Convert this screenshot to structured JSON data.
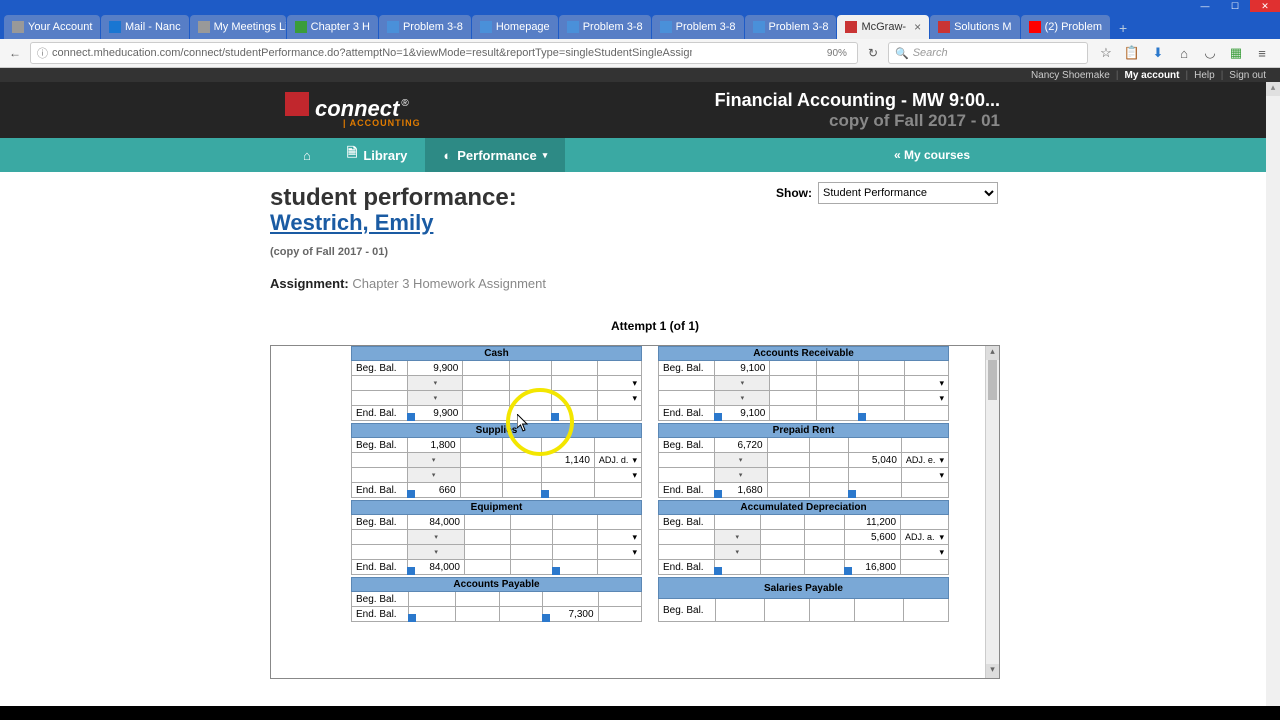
{
  "window": {
    "min": "—",
    "max": "☐",
    "close": "✕"
  },
  "tabs": [
    {
      "label": "Your Account",
      "icon": "generic"
    },
    {
      "label": "Mail - Nanc",
      "icon": "outlook"
    },
    {
      "label": "My Meetings List",
      "icon": "generic"
    },
    {
      "label": "Chapter 3 H",
      "icon": "green"
    },
    {
      "label": "Problem 3-8",
      "icon": "blue"
    },
    {
      "label": "Homepage",
      "icon": "blue"
    },
    {
      "label": "Problem 3-8",
      "icon": "blue"
    },
    {
      "label": "Problem 3-8",
      "icon": "blue"
    },
    {
      "label": "Problem 3-8",
      "icon": "blue"
    },
    {
      "label": "McGraw-",
      "icon": "red",
      "active": true,
      "closeable": true
    },
    {
      "label": "Solutions M",
      "icon": "red"
    },
    {
      "label": "(2) Problem",
      "icon": "yt"
    }
  ],
  "nav": {
    "back": "←",
    "lock": "ⓘ",
    "url": "connect.mheducation.com/connect/studentPerformance.do?attemptNo=1&viewMode=result&reportType=singleStudentSingleAssignment&peek=tru",
    "zoom": "90%",
    "reload": "↻",
    "search_icon": "🔍",
    "search_placeholder": "Search"
  },
  "nav_icons": {
    "star": "☆",
    "list": "📋",
    "dl": "⬇",
    "home": "⌂",
    "pocket": "◡",
    "grid": "▦",
    "menu": "≡"
  },
  "topstrip": {
    "user": "Nancy Shoemake",
    "myaccount": "My account",
    "help": "Help",
    "signout": "Sign out"
  },
  "brand": {
    "name": "connect",
    "reg": "®",
    "sub": "| ACCOUNTING",
    "course": "Financial Accounting - MW 9:00...",
    "term": "copy of Fall 2017 - 01"
  },
  "menu": {
    "home_icon": "⌂",
    "library_icon": "🗎",
    "library": "Library",
    "perf_icon": "◐",
    "performance": "Performance",
    "caret": "▾",
    "mycourses": "« My courses"
  },
  "content": {
    "heading": "student performance:",
    "student": "Westrich, Emily",
    "copyof": "(copy of Fall 2017 - 01)",
    "assignment_lbl": "Assignment:",
    "assignment_val": "Chapter 3 Homework Assignment",
    "show_lbl": "Show:",
    "show_val": "Student Performance",
    "attempt": "Attempt 1 (of 1)"
  },
  "accounts": [
    {
      "left": {
        "title": "Cash",
        "beg": "9,900",
        "rows": [
          {
            "dr": "",
            "drn": "",
            "cr": "",
            "crn": ""
          },
          {
            "dr": "",
            "drn": "",
            "cr": "",
            "crn": ""
          }
        ],
        "end": "9,900"
      },
      "right": {
        "title": "Accounts Receivable",
        "beg": "9,100",
        "rows": [
          {
            "dr": "",
            "drn": "",
            "cr": "",
            "crn": ""
          },
          {
            "dr": "",
            "drn": "",
            "cr": "",
            "crn": ""
          }
        ],
        "end": "9,100"
      }
    },
    {
      "left": {
        "title": "Supplies",
        "beg": "1,800",
        "rows": [
          {
            "dr": "",
            "drn": "",
            "cr": "1,140",
            "crn": "ADJ. d."
          },
          {
            "dr": "",
            "drn": "",
            "cr": "",
            "crn": ""
          }
        ],
        "end": "660"
      },
      "right": {
        "title": "Prepaid Rent",
        "beg": "6,720",
        "rows": [
          {
            "dr": "",
            "drn": "",
            "cr": "5,040",
            "crn": "ADJ. e."
          },
          {
            "dr": "",
            "drn": "",
            "cr": "",
            "crn": ""
          }
        ],
        "end": "1,680"
      }
    },
    {
      "left": {
        "title": "Equipment",
        "beg": "84,000",
        "rows": [
          {
            "dr": "",
            "drn": "",
            "cr": "",
            "crn": ""
          },
          {
            "dr": "",
            "drn": "",
            "cr": "",
            "crn": ""
          }
        ],
        "end": "84,000"
      },
      "right": {
        "title": "Accumulated Depreciation",
        "beg": "11,200",
        "begSide": "cr",
        "rows": [
          {
            "dr": "",
            "drn": "",
            "cr": "5,600",
            "crn": "ADJ. a."
          },
          {
            "dr": "",
            "drn": "",
            "cr": "",
            "crn": ""
          }
        ],
        "end": "16,800",
        "endSide": "cr"
      }
    },
    {
      "left": {
        "title": "Accounts Payable",
        "beg": "",
        "begSide": "cr",
        "rows": [],
        "end": "7,300",
        "endSide": "cr",
        "partial": true
      },
      "right": {
        "title": "Salaries Payable",
        "beg": "",
        "rows": [],
        "end": "",
        "partial": true
      }
    }
  ],
  "tacc_labels": {
    "beg": "Beg. Bal.",
    "end": "End. Bal.",
    "dd": "▾"
  }
}
